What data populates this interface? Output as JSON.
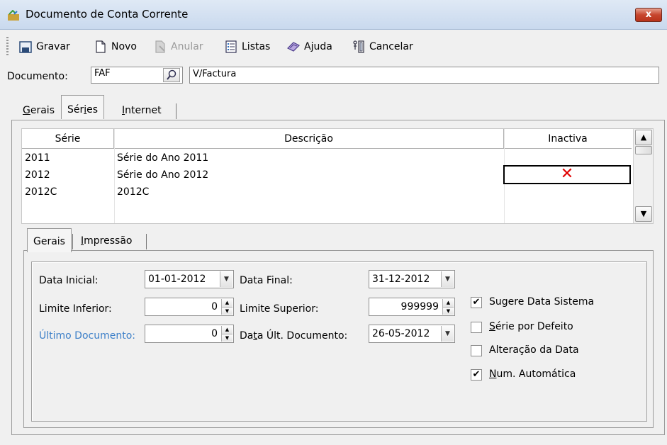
{
  "window": {
    "title": "Documento de Conta Corrente",
    "close_glyph": "x"
  },
  "toolbar": {
    "gravar": "Gravar",
    "novo": "Novo",
    "anular": "Anular",
    "listas": "Listas",
    "ajuda": "Ajuda",
    "cancelar": "Cancelar"
  },
  "document": {
    "label": "Documento:",
    "code": "FAF",
    "description": "V/Factura"
  },
  "top_tabs": [
    {
      "pre": "",
      "ul": "G",
      "post": "erais"
    },
    {
      "pre": "Sér",
      "ul": "i",
      "post": "es"
    },
    {
      "pre": "",
      "ul": "I",
      "post": "nternet"
    }
  ],
  "grid": {
    "headers": [
      "Série",
      "Descrição",
      "Inactiva"
    ],
    "rows": [
      {
        "serie": "2011",
        "descricao": "Série do Ano 2011",
        "inactiva": ""
      },
      {
        "serie": "2012",
        "descricao": "Série do Ano 2012",
        "inactiva": "✕"
      },
      {
        "serie": "2012C",
        "descricao": "2012C",
        "inactiva": ""
      }
    ],
    "scroll_up": "▲",
    "scroll_down": "▼"
  },
  "inner_tabs": [
    {
      "pre": "Gerais",
      "ul": "",
      "post": ""
    },
    {
      "pre": "",
      "ul": "I",
      "post": "mpressão"
    }
  ],
  "form": {
    "data_inicial_label": "Data Inicial:",
    "data_inicial": "01-01-2012",
    "data_final_label": "Data Final:",
    "data_final": "31-12-2012",
    "limite_inferior_label": "Limite Inferior:",
    "limite_inferior": "0",
    "limite_superior_label": "Limite Superior:",
    "limite_superior": "999999",
    "ultimo_documento_label": "Último Documento:",
    "ultimo_documento": "0",
    "data_ult_label_pre": "Da",
    "data_ult_label_ul": "t",
    "data_ult_label_post": "a Últ. Documento:",
    "data_ult_documento": "26-05-2012"
  },
  "checkboxes": [
    {
      "pre": "",
      "ul": "",
      "post": "Sugere Data Sistema",
      "checked": true
    },
    {
      "pre": "",
      "ul": "S",
      "post": "érie por Defeito",
      "checked": false
    },
    {
      "pre": "",
      "ul": "",
      "post": "Alteração da Data",
      "checked": false
    },
    {
      "pre": "",
      "ul": "N",
      "post": "um. Automática",
      "checked": true
    }
  ],
  "colors": {
    "link": "#3c7fc8",
    "error_mark": "#e00000",
    "close_red": "#c7462e"
  }
}
